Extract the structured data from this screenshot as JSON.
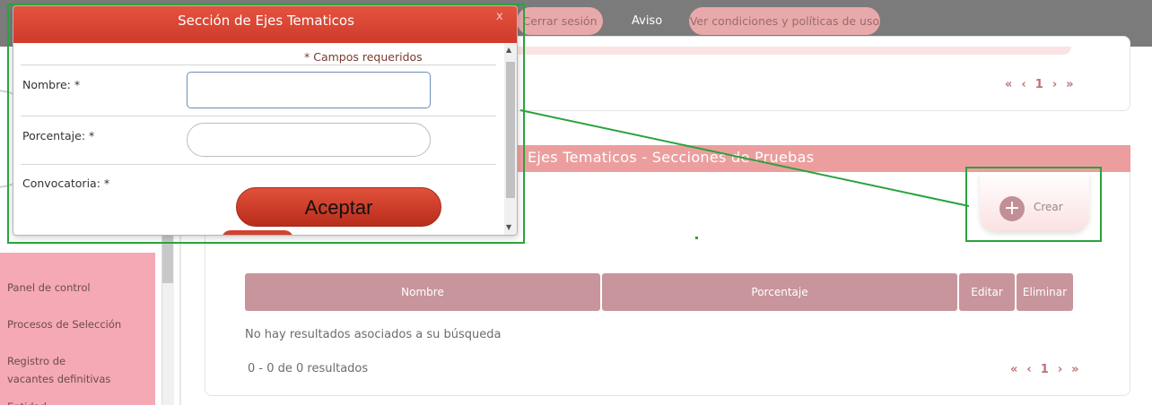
{
  "topbar": {
    "logout_label": "Cerrar sesión",
    "aviso_label": "Aviso",
    "terms_label": "Ver condiciones y políticas de uso"
  },
  "sidebar": {
    "items": [
      {
        "label": "Panel de control"
      },
      {
        "label": "Procesos de Selección"
      },
      {
        "label": "Registro de vacantes definitivas"
      },
      {
        "label": "Entidad"
      }
    ]
  },
  "top_panel": {
    "pager": {
      "first": "«",
      "prev": "‹",
      "page": "1",
      "next": "›",
      "last": "»"
    }
  },
  "section_panel": {
    "title": "Ejes Tematicos - Secciones de Pruebas",
    "create_label": "Crear",
    "create_icon": "plus-icon",
    "table": {
      "columns": [
        "Nombre",
        "Porcentaje",
        "Editar",
        "Eliminar"
      ],
      "empty_message": "No hay resultados asociados a su búsqueda"
    },
    "result_count": "0 - 0 de 0 resultados",
    "pager": {
      "first": "«",
      "prev": "‹",
      "page": "1",
      "next": "›",
      "last": "»"
    }
  },
  "modal": {
    "title": "Sección de Ejes Tematicos",
    "close_label": "x",
    "required_note": "* Campos requeridos",
    "fields": {
      "nombre_label": "Nombre: *",
      "nombre_value": "",
      "porcentaje_label": "Porcentaje: *",
      "porcentaje_value": "",
      "convocatoria_label": "Convocatoria: *"
    },
    "accept_label": "Aceptar"
  },
  "colors": {
    "modal_header": "#d9452f",
    "table_header": "#c8959c",
    "sidebar": "#f4a9b4",
    "annotation": "#2aa33c"
  }
}
